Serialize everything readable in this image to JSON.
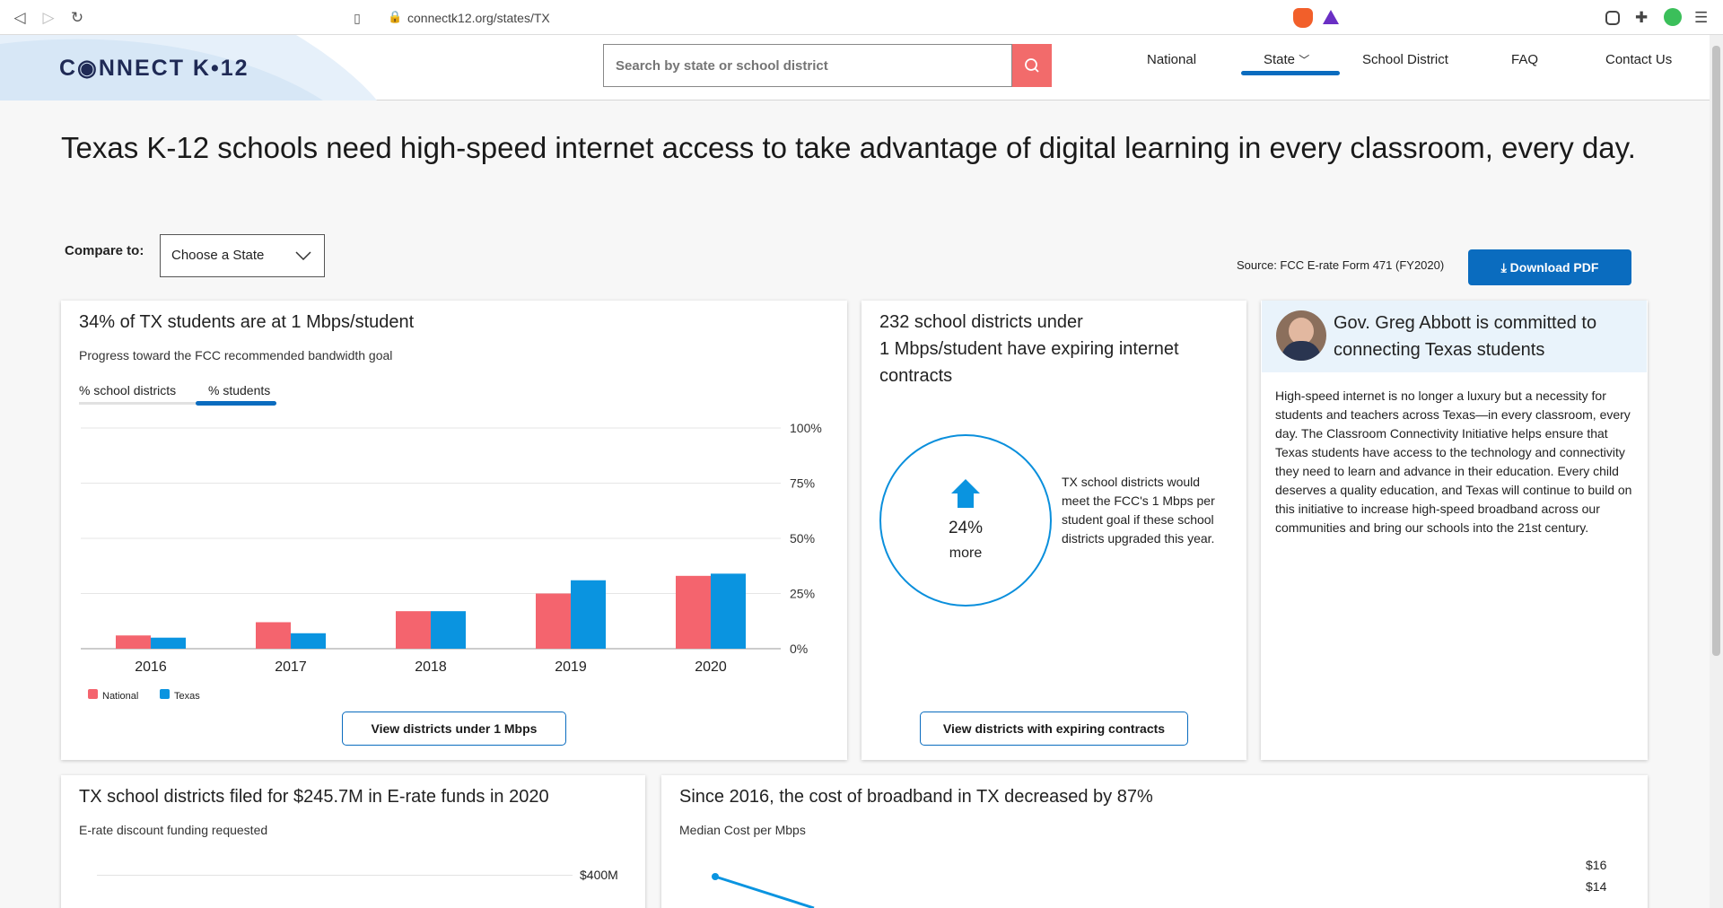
{
  "browser": {
    "url": "connectk12.org/states/TX"
  },
  "header": {
    "logo": "C◉NNECT K•12",
    "search_placeholder": "Search by state or school district",
    "nav": [
      "National",
      "State",
      "School District",
      "FAQ",
      "Contact Us"
    ]
  },
  "headline": "Texas K-12 schools need high-speed internet access to take advantage of digital learning in every classroom, every day.",
  "compare": {
    "label": "Compare to:",
    "selected": "Choose a State"
  },
  "source": "Source: FCC E-rate Form 471 (FY2020)",
  "download_label": "Download PDF",
  "card_students": {
    "title": "34% of TX students are at 1 Mbps/student",
    "subtitle": "Progress toward the FCC recommended bandwidth goal",
    "tabs": [
      "% school districts",
      "% students"
    ],
    "button": "View districts under 1 Mbps"
  },
  "card_contracts": {
    "title_lines": [
      "232 school districts under",
      "1 Mbps/student have expiring internet",
      "contracts"
    ],
    "pct": "24%",
    "more": "more",
    "description": "TX school districts would meet the FCC's 1 Mbps per student goal if these school districts upgraded this year.",
    "button": "View districts with expiring contracts"
  },
  "card_governor": {
    "title": "Gov. Greg Abbott is committed to connecting Texas students",
    "body": "High-speed internet is no longer a luxury but a necessity for students and teachers across Texas—in every classroom, every day. The Classroom Connectivity Initiative helps ensure that Texas students have access to the technology and connectivity they need to learn and advance in their education. Every child deserves a quality education, and Texas will continue to build on this initiative to increase high-speed broadband across our communities and bring our schools into the 21st century."
  },
  "card_erate": {
    "title": "TX school districts filed for $245.7M in E-rate funds in 2020",
    "subtitle": "E-rate discount funding requested",
    "tick": "$400M"
  },
  "card_cost": {
    "title": "Since 2016, the cost of broadband in TX decreased by 87%",
    "subtitle": "Median Cost per Mbps",
    "ticks": [
      "$16",
      "$14"
    ]
  },
  "colors": {
    "national": "#f4646e",
    "texas": "#0a94e0",
    "accent": "#0a6cbf",
    "search": "#f26b6b"
  },
  "chart_data": {
    "type": "bar",
    "categories": [
      "2016",
      "2017",
      "2018",
      "2019",
      "2020"
    ],
    "series": [
      {
        "name": "National",
        "values": [
          6,
          12,
          17,
          25,
          33
        ]
      },
      {
        "name": "Texas",
        "values": [
          5,
          7,
          17,
          31,
          34
        ]
      }
    ],
    "ylim": [
      0,
      100
    ],
    "yticks": [
      "0%",
      "25%",
      "50%",
      "75%",
      "100%"
    ],
    "legend": "bottom-left"
  }
}
